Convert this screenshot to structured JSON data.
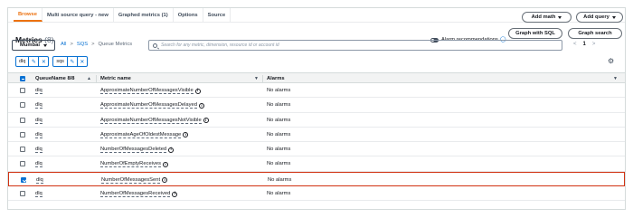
{
  "tabs": [
    "Browse",
    "Multi source query - new",
    "Graphed metrics (1)",
    "Options",
    "Source"
  ],
  "buttons": {
    "add_math": "Add math",
    "add_query": "Add query",
    "graph_sql": "Graph with SQL",
    "graph_search": "Graph search"
  },
  "header": {
    "title": "Metrics",
    "count": "(8)",
    "alarm_recommendations": "Alarm recommendations"
  },
  "region": "Mumbai",
  "breadcrumb": {
    "all": "All",
    "sqs": "SQS",
    "current": "Queue Metrics"
  },
  "search": {
    "placeholder": "Search for any metric, dimension, resource id or account id"
  },
  "pager": {
    "page": "1"
  },
  "chips": [
    {
      "label": "dlq"
    },
    {
      "label": "sqs"
    }
  ],
  "table": {
    "headers": {
      "queue": "QueueName 8/8",
      "metric": "Metric name",
      "alarms": "Alarms"
    },
    "rows": [
      {
        "queue": "dlq",
        "metric": "ApproximateNumberOfMessagesVisible",
        "alarms": "No alarms",
        "checked": false
      },
      {
        "queue": "dlq",
        "metric": "ApproximateNumberOfMessagesDelayed",
        "alarms": "No alarms",
        "checked": false
      },
      {
        "queue": "dlq",
        "metric": "ApproximateNumberOfMessagesNotVisible",
        "alarms": "No alarms",
        "checked": false
      },
      {
        "queue": "dlq",
        "metric": "ApproximateAgeOfOldestMessage",
        "alarms": "No alarms",
        "checked": false
      },
      {
        "queue": "dlq",
        "metric": "NumberOfMessagesDeleted",
        "alarms": "No alarms",
        "checked": false
      },
      {
        "queue": "dlq",
        "metric": "NumberOfEmptyReceives",
        "alarms": "No alarms",
        "checked": false
      },
      {
        "queue": "dlq",
        "metric": "NumberOfMessagesSent",
        "alarms": "No alarms",
        "checked": true
      },
      {
        "queue": "dlq",
        "metric": "NumberOfMessagesReceived",
        "alarms": "No alarms",
        "checked": false
      }
    ]
  },
  "colors": {
    "accent": "#ec7211",
    "link": "#0972d3",
    "selected_border": "#d13212"
  },
  "icons": [
    "search-icon",
    "info-icon",
    "settings-icon",
    "lightbulb-icon",
    "edit-icon",
    "close-icon",
    "chevron-left-icon",
    "chevron-right-icon",
    "sort-icon"
  ]
}
